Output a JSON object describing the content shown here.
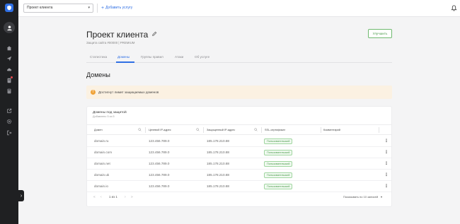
{
  "topbar": {
    "project_select_value": "Проект клиента",
    "add_service_label": "Добавить услугу"
  },
  "page": {
    "title": "Проект клиента",
    "subtitle": "Защита сайта #00000 | PREMIUM",
    "upgrade_label": "Улучшить",
    "section_title": "Домены"
  },
  "tabs": [
    {
      "label": "Статистика",
      "active": false
    },
    {
      "label": "Домены",
      "active": true
    },
    {
      "label": "Группы правил",
      "active": false
    },
    {
      "label": "Атаки",
      "active": false
    },
    {
      "label": "Об услуге",
      "active": false
    }
  ],
  "alert": {
    "text": "Достигнут лимит защищаемых доменов",
    "color": "#fbf1e2"
  },
  "table": {
    "title": "Домены под защитой",
    "subtitle": "Добавлено 5 из 5",
    "columns": [
      "Домен",
      "Целевой IP-адрес",
      "Защищенный IP-адрес",
      "SSL-сертификат",
      "Комментарий"
    ],
    "rows": [
      {
        "domain": "domain.ru",
        "target_ip": "123.456.789.0",
        "protected_ip": "185.178.210.88",
        "ssl": "Пользовательский",
        "comment": ""
      },
      {
        "domain": "domain.com",
        "target_ip": "123.456.789.0",
        "protected_ip": "185.178.210.88",
        "ssl": "Пользовательский",
        "comment": ""
      },
      {
        "domain": "domain.net",
        "target_ip": "123.456.789.0",
        "protected_ip": "185.178.210.88",
        "ssl": "Пользовательский",
        "comment": ""
      },
      {
        "domain": "domain.uk",
        "target_ip": "123.456.789.0",
        "protected_ip": "185.178.210.88",
        "ssl": "Пользовательский",
        "comment": ""
      },
      {
        "domain": "domain.io",
        "target_ip": "123.456.789.0",
        "protected_ip": "185.178.210.88",
        "ssl": "Пользовательский",
        "comment": ""
      }
    ],
    "pagination": {
      "page_text": "1 из 1",
      "per_page_text": "Показывать по 10 записей"
    }
  },
  "colors": {
    "accent": "#2f6fe4",
    "success": "#4a9a4a",
    "sidebar": "#1f2022"
  }
}
